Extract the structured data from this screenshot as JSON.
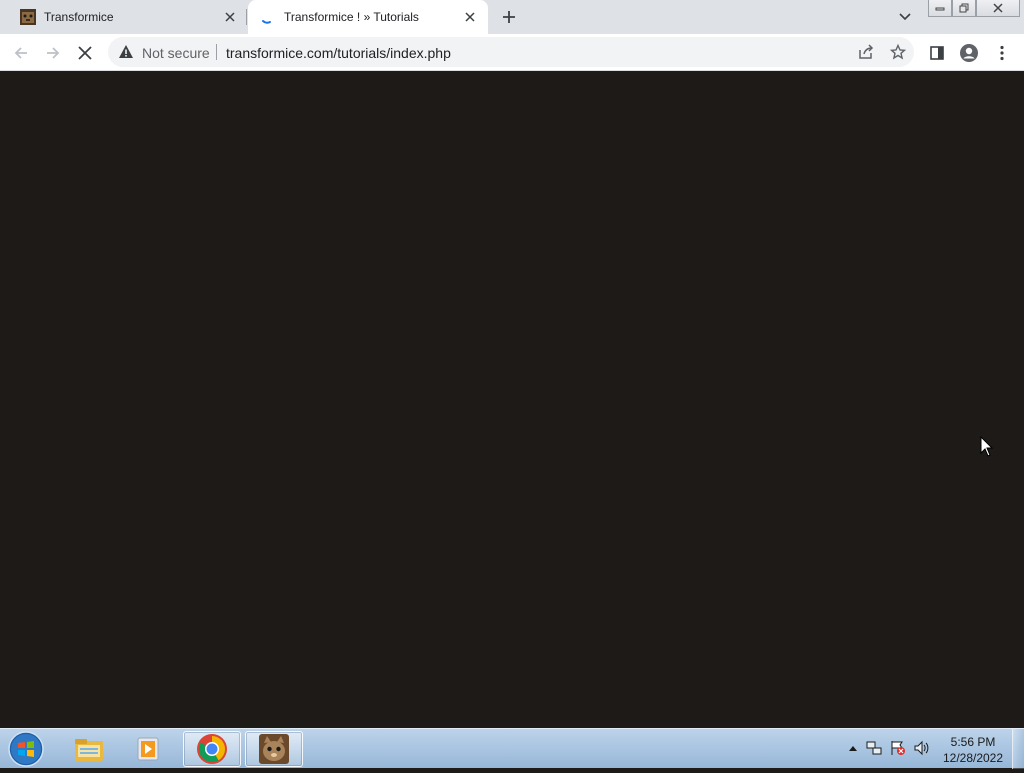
{
  "browser": {
    "tabs": [
      {
        "title": "Transformice",
        "favicon": "mouse-favicon-icon",
        "active": false
      },
      {
        "title": "Transformice ! » Tutorials",
        "favicon": "loading-spinner-icon",
        "active": true
      }
    ],
    "address_bar": {
      "security_label": "Not secure",
      "url": "transformice.com/tutorials/index.php"
    }
  },
  "content": {
    "background_color": "#1e1a17"
  },
  "taskbar": {
    "pinned_apps": [
      "windows-explorer-icon",
      "media-player-icon",
      "chrome-icon",
      "transformice-icon"
    ],
    "clock": {
      "time": "5:56 PM",
      "date": "12/28/2022"
    }
  }
}
